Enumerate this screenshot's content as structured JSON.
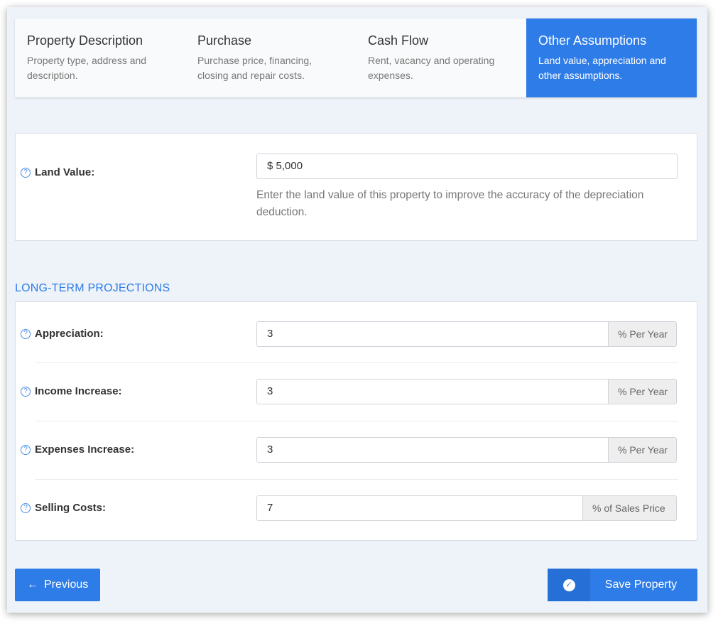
{
  "steps": [
    {
      "title": "Property Description",
      "desc": "Property type, address and description."
    },
    {
      "title": "Purchase",
      "desc": "Purchase price, financing, closing and repair costs."
    },
    {
      "title": "Cash Flow",
      "desc": "Rent, vacancy and operating expenses."
    },
    {
      "title": "Other Assumptions",
      "desc": "Land value, appreciation and other assumptions."
    }
  ],
  "active_step": 3,
  "land": {
    "label": "Land Value:",
    "value": "$ 5,000",
    "hint": "Enter the land value of this property to improve the accuracy of the depreciation deduction."
  },
  "projections": {
    "section_title": "LONG-TERM PROJECTIONS",
    "fields": [
      {
        "label": "Appreciation:",
        "value": "3",
        "unit": "%  Per Year"
      },
      {
        "label": "Income Increase:",
        "value": "3",
        "unit": "%  Per Year"
      },
      {
        "label": "Expenses Increase:",
        "value": "3",
        "unit": "%  Per Year"
      },
      {
        "label": "Selling Costs:",
        "value": "7",
        "unit": "%  of Sales Price"
      }
    ]
  },
  "buttons": {
    "previous": "Previous",
    "save": "Save Property"
  },
  "icons": {
    "help": "?",
    "arrow_left": "←",
    "check": "✓"
  },
  "colors": {
    "accent": "#2e7ce8",
    "background": "#eef3f9"
  }
}
